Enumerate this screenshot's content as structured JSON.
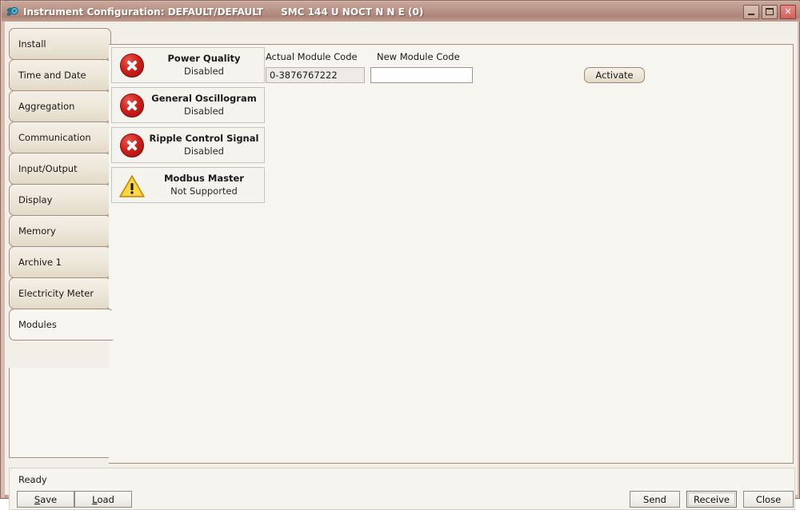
{
  "window": {
    "icon_name": "instrument-app-icon",
    "title": "Instrument Configuration: DEFAULT/DEFAULT",
    "subtitle": "SMC 144 U NOCT N N E (0)",
    "minimize_label": "Minimize",
    "maximize_label": "Maximize",
    "close_label": "Close",
    "close_glyph": "✕",
    "frame_color": "#b08f82",
    "titlebar_color": "#b99287",
    "close_button_color": "#d2615c"
  },
  "tabs": [
    {
      "label": "Install",
      "selected": false
    },
    {
      "label": "Time and Date",
      "selected": false
    },
    {
      "label": "Aggregation",
      "selected": false
    },
    {
      "label": "Communication",
      "selected": false
    },
    {
      "label": "Input/Output",
      "selected": false
    },
    {
      "label": "Display",
      "selected": false
    },
    {
      "label": "Memory",
      "selected": false
    },
    {
      "label": "Archive 1",
      "selected": false
    },
    {
      "label": "Electricity Meter",
      "selected": false
    },
    {
      "label": "Modules",
      "selected": true
    }
  ],
  "modules": [
    {
      "name": "Power Quality",
      "status": "Disabled",
      "icon": "error-icon"
    },
    {
      "name": "General Oscillogram",
      "status": "Disabled",
      "icon": "error-icon"
    },
    {
      "name": "Ripple Control Signal",
      "status": "Disabled",
      "icon": "error-icon"
    },
    {
      "name": "Modbus Master",
      "status": "Not Supported",
      "icon": "warning-icon"
    }
  ],
  "module_code": {
    "actual_label": "Actual Module Code",
    "actual_value": "0-3876767222",
    "new_label": "New Module Code",
    "new_value": "",
    "new_placeholder": "",
    "activate_label": "Activate"
  },
  "statusbar": {
    "text": "Ready"
  },
  "buttons": {
    "save": {
      "accel": "S",
      "rest": "ave"
    },
    "load": {
      "accel": "L",
      "rest": "oad"
    },
    "send": "Send",
    "receive": "Receive",
    "close": "Close"
  },
  "colors": {
    "error": "#cf1f1a",
    "warning": "#f5c518",
    "panel": "#f7f5f0",
    "tab_unselected": "#ece6d8"
  }
}
